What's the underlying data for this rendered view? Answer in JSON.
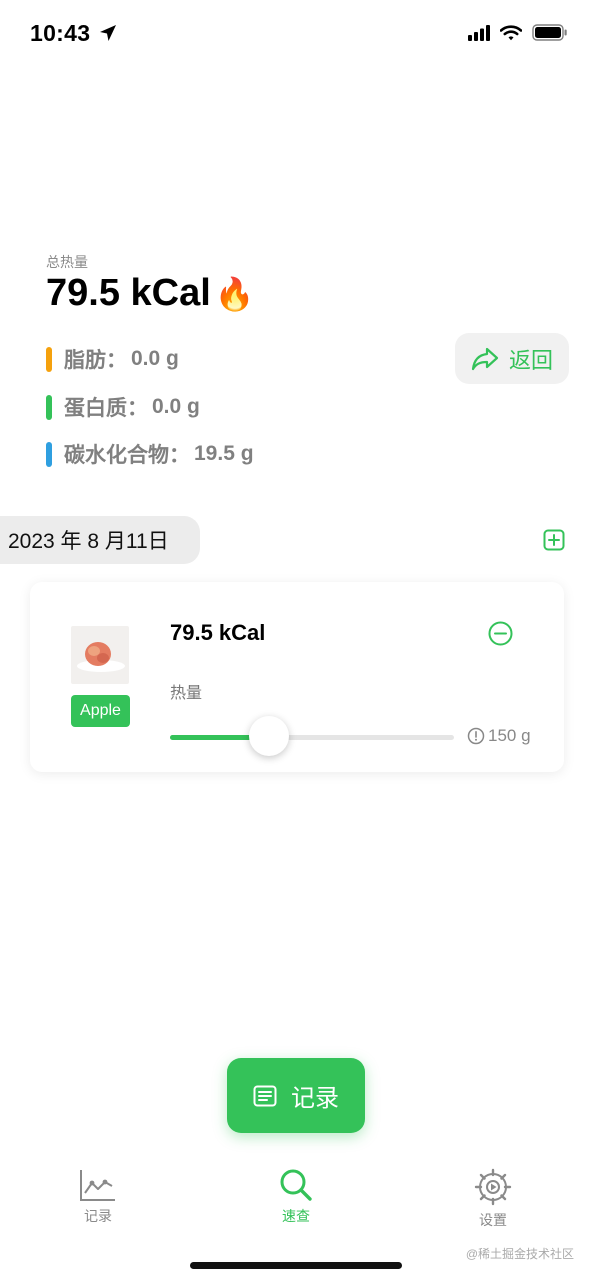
{
  "status_bar": {
    "time": "10:43",
    "icons": [
      "location-arrow-icon",
      "signal-icon",
      "wifi-icon",
      "battery-icon"
    ]
  },
  "summary": {
    "total_label": "总热量",
    "total_value": "79.5 kCal",
    "total_emoji": "🔥",
    "nutrients": [
      {
        "name": "脂肪：",
        "value": "0.0 g",
        "color": "#f5a10d"
      },
      {
        "name": "蛋白质：",
        "value": "0.0 g",
        "color": "#34c259"
      },
      {
        "name": "碳水化合物：",
        "value": "19.5 g",
        "color": "#2f9fe0"
      }
    ]
  },
  "back_button": {
    "label": "返回",
    "icon": "share-forward-icon"
  },
  "date_section": {
    "date": "2023 年 8 月11日",
    "add_icon": "plus-square-icon"
  },
  "food_item": {
    "image": "apple-photo",
    "tag": "Apple",
    "kcal": "79.5 kCal",
    "calorie_label": "热量",
    "remove_icon": "minus-circle-icon",
    "slider_fraction": 0.35,
    "weight_icon": "info-circle-icon",
    "weight": "150 g"
  },
  "record_button": {
    "label": "记录",
    "icon": "list-doc-icon"
  },
  "tab_bar": {
    "active_color": "#34c259",
    "inactive_color": "#8a8a8a",
    "tabs": [
      {
        "label": "记录",
        "icon": "line-chart-icon",
        "active": false
      },
      {
        "label": "速查",
        "icon": "search-icon",
        "active": true
      },
      {
        "label": "设置",
        "icon": "gear-icon",
        "active": false
      }
    ]
  },
  "watermark": "@稀土掘金技术社区"
}
